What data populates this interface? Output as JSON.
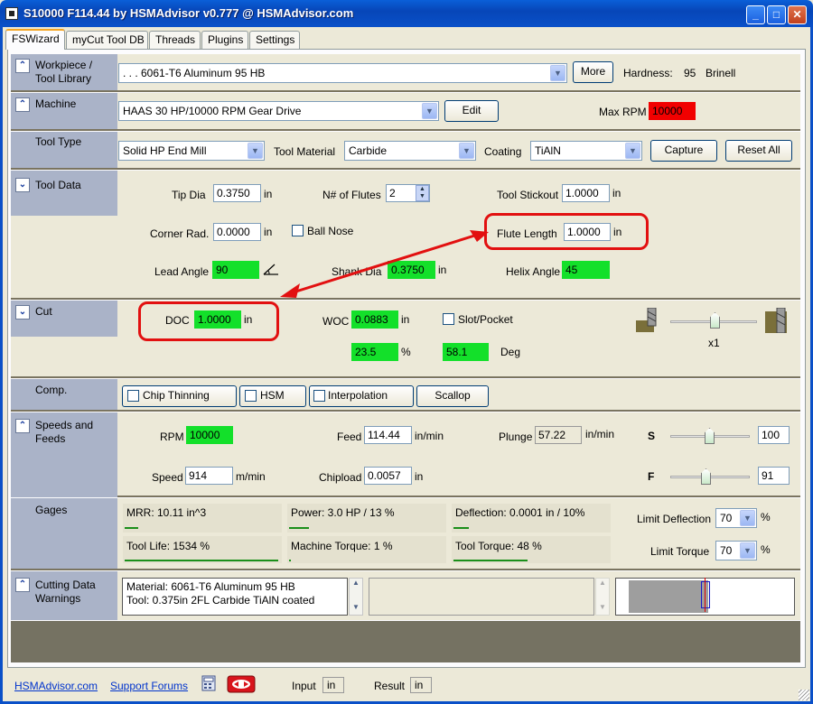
{
  "window": {
    "title": "S10000 F114.44 by HSMAdvisor v0.777 @ HSMAdvisor.com"
  },
  "tabs": [
    "FSWizard",
    "myCut Tool DB",
    "Threads",
    "Plugins",
    "Settings"
  ],
  "workpiece": {
    "label_line1": "Workpiece /",
    "label_line2": "Tool Library",
    "material": ". . . 6061-T6 Aluminum 95 HB",
    "more_label": "More",
    "hardness_label": "Hardness:",
    "hardness_value": "95",
    "hardness_unit": "Brinell"
  },
  "machine": {
    "label": "Machine",
    "value": "HAAS 30 HP/10000 RPM Gear Drive",
    "edit_label": "Edit",
    "max_rpm_label": "Max RPM",
    "max_rpm_value": "10000"
  },
  "tool_type": {
    "label": "Tool Type",
    "type_value": "Solid HP End Mill",
    "material_label": "Tool Material",
    "material_value": "Carbide",
    "coating_label": "Coating",
    "coating_value": "TiAlN",
    "capture_label": "Capture",
    "reset_label": "Reset All"
  },
  "tool_data": {
    "label": "Tool Data",
    "tip_dia_label": "Tip Dia",
    "tip_dia_value": "0.3750",
    "tip_dia_unit": "in",
    "flutes_label": "N# of Flutes",
    "flutes_value": "2",
    "stickout_label": "Tool Stickout",
    "stickout_value": "1.0000",
    "stickout_unit": "in",
    "corner_label": "Corner Rad.",
    "corner_value": "0.0000",
    "corner_unit": "in",
    "ballnose_label": "Ball Nose",
    "flute_len_label": "Flute Length",
    "flute_len_value": "1.0000",
    "flute_len_unit": "in",
    "lead_label": "Lead Angle",
    "lead_value": "90",
    "shank_label": "Shank Dia",
    "shank_value": "0.3750",
    "shank_unit": "in",
    "helix_label": "Helix Angle",
    "helix_value": "45"
  },
  "cut": {
    "label": "Cut",
    "doc_label": "DOC",
    "doc_value": "1.0000",
    "doc_unit": "in",
    "woc_label": "WOC",
    "woc_value": "0.0883",
    "woc_unit": "in",
    "slot_label": "Slot/Pocket",
    "pct_value": "23.5",
    "pct_unit": "%",
    "deg_value": "58.1",
    "deg_unit": "Deg",
    "multiplier": "x1"
  },
  "comp": {
    "label": "Comp.",
    "chip_thinning": "Chip Thinning",
    "hsm": "HSM",
    "interpolation": "Interpolation",
    "scallop": "Scallop"
  },
  "speeds": {
    "label_line1": "Speeds and",
    "label_line2": "Feeds",
    "rpm_label": "RPM",
    "rpm_value": "10000",
    "feed_label": "Feed",
    "feed_value": "114.44",
    "feed_unit": "in/min",
    "plunge_label": "Plunge",
    "plunge_value": "57.22",
    "plunge_unit": "in/min",
    "s_label": "S",
    "s_value": "100",
    "speed_label": "Speed",
    "speed_value": "914",
    "speed_unit": "m/min",
    "chipload_label": "Chipload",
    "chipload_value": "0.0057",
    "chipload_unit": "in",
    "f_label": "F",
    "f_value": "91"
  },
  "gages": {
    "label": "Gages",
    "mrr": "MRR: 10.11 in^3",
    "power": "Power: 3.0 HP / 13 %",
    "deflection": "Deflection: 0.0001 in / 10%",
    "tool_life": "Tool Life: 1534 %",
    "machine_torque": "Machine Torque: 1 %",
    "tool_torque": "Tool Torque: 48 %",
    "limit_deflection_label": "Limit Deflection",
    "limit_deflection_value": "70",
    "limit_torque_label": "Limit Torque",
    "limit_torque_value": "70",
    "pct": "%",
    "power_level": 0.13,
    "deflection_level": 0.1,
    "tool_life_level": 1.0,
    "machine_torque_level": 0.01,
    "tool_torque_level": 0.48
  },
  "warnings": {
    "label_line1": "Cutting Data",
    "label_line2": "Warnings",
    "line1": "Material: 6061-T6 Aluminum 95 HB",
    "line2": "Tool: 0.375in 2FL Carbide TiAlN coated"
  },
  "footer": {
    "link1": "HSMAdvisor.com",
    "link2": "Support Forums",
    "input_label": "Input",
    "input_unit": "in",
    "result_label": "Result",
    "result_unit": "in"
  },
  "colors": {
    "green": "#13e02a",
    "red": "#f10000",
    "annotation": "#e21010"
  }
}
